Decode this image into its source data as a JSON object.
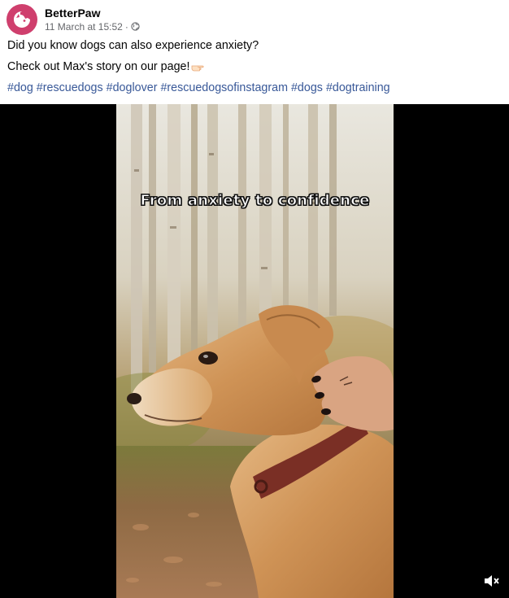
{
  "header": {
    "page_name": "BetterPaw",
    "timestamp": "11 March at 15:52",
    "separator": "·"
  },
  "caption": {
    "line1": "Did you know dogs can also experience anxiety?",
    "line2": "Check out Max's story on our page!",
    "hashtags": [
      "#dog",
      "#rescuedogs",
      "#doglover",
      "#rescuedogsofinstagram",
      "#dogs",
      "#dogtraining"
    ]
  },
  "video": {
    "overlay_text": "From anxiety to confidence",
    "muted": true
  },
  "colors": {
    "brand": "#cf3f6d",
    "hashtag": "#385898",
    "secondary_text": "#65676b"
  }
}
